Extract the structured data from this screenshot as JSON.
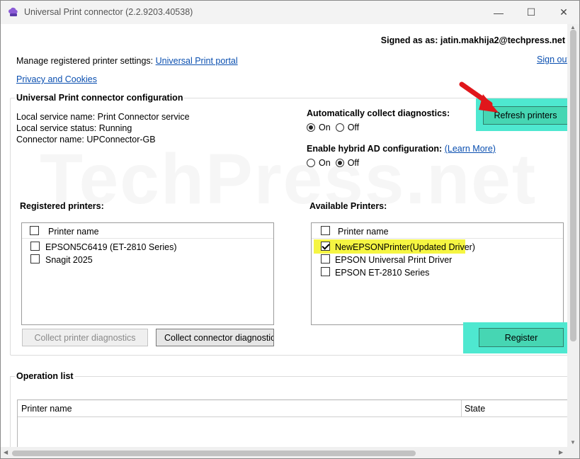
{
  "window": {
    "title": "Universal Print connector (2.2.9203.40538)",
    "min_glyph": "—",
    "max_glyph": "☐",
    "close_glyph": "✕"
  },
  "watermark": "TechPress.net",
  "account": {
    "signed_in": "Signed as as: jatin.makhija2@techpress.net",
    "sign_out": "Sign out"
  },
  "manage": {
    "label": "Manage registered printer settings: ",
    "portal_link": "Universal Print portal",
    "privacy_link": "Privacy and Cookies"
  },
  "config": {
    "title": "Universal Print connector configuration",
    "local_service_name": "Local service name: Print Connector service",
    "local_service_status": "Local service status: Running",
    "connector_name": "Connector name: UPConnector-GB",
    "diagnostics_label": "Automatically collect diagnostics:",
    "diagnostics_on": "On",
    "diagnostics_off": "Off",
    "diagnostics_value": "On",
    "hybrid_label": "Enable hybrid AD configuration:",
    "hybrid_learn_more": "(Learn More)",
    "hybrid_on": "On",
    "hybrid_off": "Off",
    "hybrid_value": "Off",
    "refresh_button": "Refresh printers"
  },
  "registered": {
    "title": "Registered printers:",
    "column": "Printer name",
    "items": [
      {
        "name": "EPSON5C6419 (ET-2810 Series)",
        "checked": false
      },
      {
        "name": "Snagit 2025",
        "checked": false
      }
    ],
    "collect_printer_button": "Collect printer diagnostics",
    "collect_connector_button": "Collect connector diagnostics"
  },
  "available": {
    "title": "Available Printers:",
    "column": "Printer name",
    "items": [
      {
        "name": "NewEPSONPrinter(Updated Driver)",
        "checked": true
      },
      {
        "name": "EPSON Universal Print Driver",
        "checked": false
      },
      {
        "name": "EPSON ET-2810 Series",
        "checked": false
      }
    ],
    "register_button": "Register"
  },
  "operations": {
    "title": "Operation list",
    "columns": [
      "Printer name",
      "State"
    ]
  },
  "colors": {
    "highlight_cyan": "#4ee8d0",
    "button_green": "#46d6b3",
    "highlight_yellow": "#f5f542",
    "arrow_red": "#e0161b",
    "link_blue": "#0a4fb0"
  }
}
